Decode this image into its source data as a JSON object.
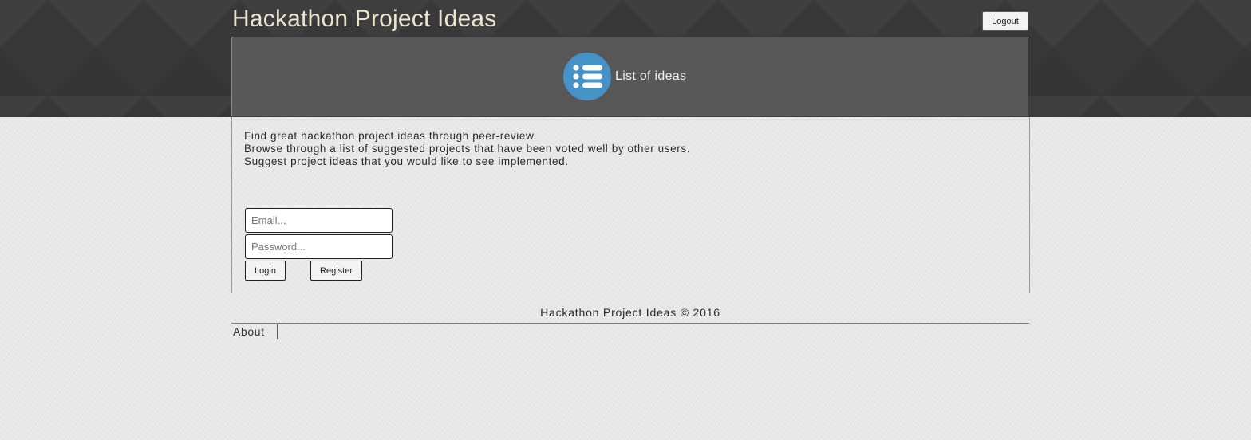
{
  "header": {
    "title": "Hackathon Project Ideas",
    "logout_label": "Logout"
  },
  "banner": {
    "icon": "list-icon",
    "label": "List of ideas",
    "icon_color": "#4592c8"
  },
  "intro": {
    "lines": [
      "Find great hackathon project ideas through peer-review.",
      "Browse through a list of suggested projects that have been voted well by other users.",
      "Suggest project ideas that you would like to see implemented."
    ]
  },
  "login_form": {
    "email_placeholder": "Email...",
    "password_placeholder": "Password...",
    "login_label": "Login",
    "register_label": "Register"
  },
  "footer": {
    "copyright": "Hackathon Project Ideas © 2016",
    "links": [
      {
        "label": "About"
      }
    ]
  },
  "colors": {
    "header_bg": "#383838",
    "title_color": "#ece4cf",
    "banner_bg": "#585858",
    "page_bg": "#e8e8e8"
  }
}
